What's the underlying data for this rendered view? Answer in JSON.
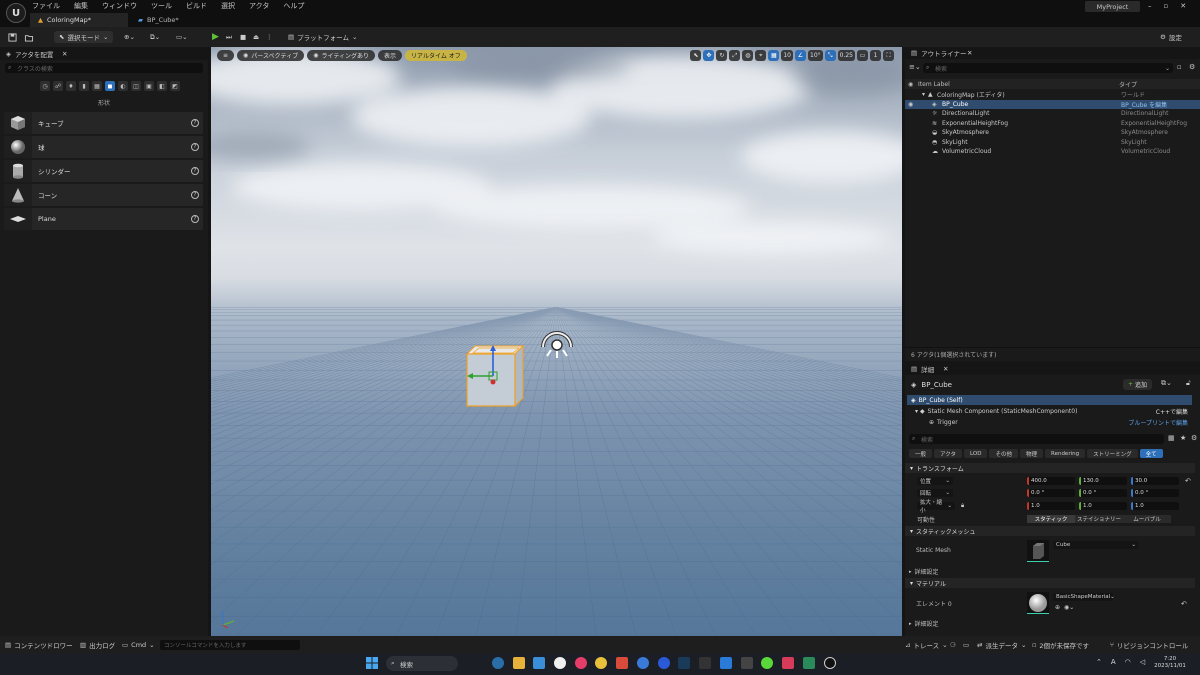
{
  "titlebar": {
    "menu": [
      "ファイル",
      "編集",
      "ウィンドウ",
      "ツール",
      "ビルド",
      "選択",
      "アクタ",
      "ヘルプ"
    ],
    "tabs": [
      {
        "label": "ColoringMap*"
      },
      {
        "label": "BP_Cube*"
      }
    ],
    "project": "MyProject"
  },
  "toolbar": {
    "mode": "選択モード",
    "platform": "プラットフォーム",
    "settings": "設定"
  },
  "place_actors": {
    "title": "アクタを配置",
    "search_placeholder": "クラスの検索",
    "section": "形状",
    "items": [
      {
        "label": "キューブ"
      },
      {
        "label": "球"
      },
      {
        "label": "シリンダー"
      },
      {
        "label": "コーン"
      },
      {
        "label": "Plane"
      }
    ]
  },
  "viewport": {
    "buttons": [
      "パースペクティブ",
      "ライティングあり",
      "表示"
    ],
    "realtime": "リアルタイム オフ",
    "snap_grid": "10",
    "snap_rot": "10°",
    "snap_scale": "0.25",
    "camera_speed": "1"
  },
  "outliner": {
    "title": "アウトライナー",
    "search_placeholder": "検索",
    "col_label": "Item Label",
    "col_type": "タイプ",
    "rows": [
      {
        "label": "ColoringMap (エディタ)",
        "type": "ワールド"
      },
      {
        "label": "BP_Cube",
        "type": "BP_Cube を編集"
      },
      {
        "label": "DirectionalLight",
        "type": "DirectionalLight"
      },
      {
        "label": "ExponentialHeightFog",
        "type": "ExponentialHeightFog"
      },
      {
        "label": "SkyAtmosphere",
        "type": "SkyAtmosphere"
      },
      {
        "label": "SkyLight",
        "type": "SkyLight"
      },
      {
        "label": "VolumetricCloud",
        "type": "VolumetricCloud"
      }
    ],
    "status": "6 アクタ(1個選択されています)"
  },
  "details": {
    "title": "詳細",
    "object": "BP_Cube",
    "add": "追加",
    "components": [
      {
        "label": "BP_Cube (Self)",
        "link": ""
      },
      {
        "label": "Static Mesh Component (StaticMeshComponent0)",
        "link": "C++で編集"
      },
      {
        "label": "Trigger",
        "link": "ブループリントで編集"
      }
    ],
    "search_placeholder": "検索",
    "filters": [
      "一般",
      "アクタ",
      "LOD",
      "その他",
      "物理",
      "Rendering",
      "ストリーミング",
      "全て"
    ],
    "transform": {
      "title": "トランスフォーム",
      "location_label": "位置",
      "rotation_label": "回転",
      "scale_label": "拡大・縮小",
      "location": [
        "400.0",
        "130.0",
        "30.0"
      ],
      "rotation": [
        "0.0 °",
        "0.0 °",
        "0.0 °"
      ],
      "scale": [
        "1.0",
        "1.0",
        "1.0"
      ],
      "mobility_label": "可動性",
      "mobility": [
        "スタティック",
        "ステイショナリー",
        "ムーバブル"
      ]
    },
    "static_mesh": {
      "title": "スタティックメッシュ",
      "label": "Static Mesh",
      "value": "Cube",
      "advanced": "詳細設定"
    },
    "materials": {
      "title": "マテリアル",
      "label": "エレメント 0",
      "value": "BasicShapeMaterial",
      "advanced": "詳細設定"
    }
  },
  "bottombar": {
    "content_drawer": "コンテンツドロワー",
    "output_log": "出力ログ",
    "cmd": "Cmd",
    "cmd_placeholder": "コンソールコマンドを入力します",
    "trace": "トレース",
    "derived_data": "派生データ",
    "unsaved": "2個が未保存です",
    "revision": "リビジョンコントロール"
  },
  "taskbar": {
    "search": "検索",
    "time": "7:20",
    "date": "2023/11/01"
  }
}
